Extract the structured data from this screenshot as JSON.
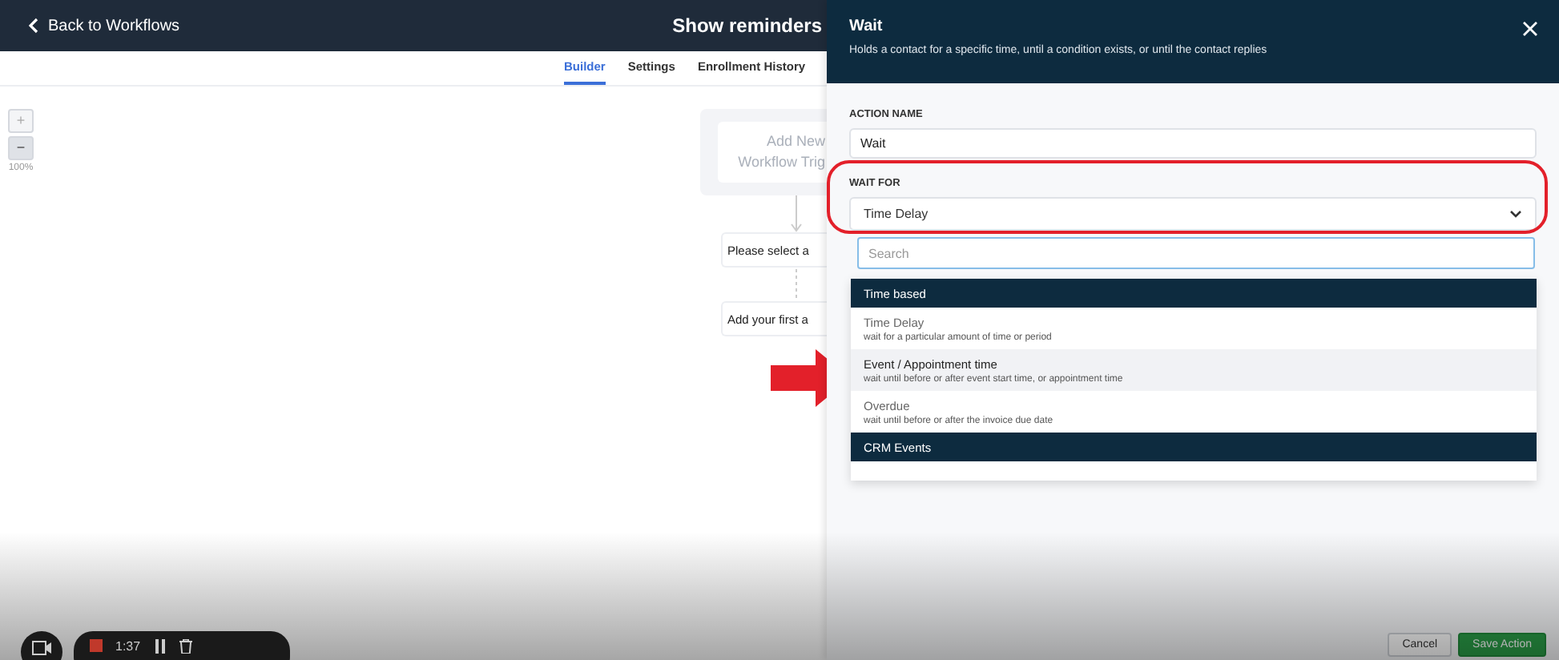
{
  "top_bar": {
    "back_label": "Back to Workflows",
    "title": "Show reminders"
  },
  "tabs": [
    {
      "label": "Builder",
      "selected": true
    },
    {
      "label": "Settings",
      "selected": false
    },
    {
      "label": "Enrollment History",
      "selected": false
    }
  ],
  "zoom_controls": {
    "zoom_in": "+",
    "zoom_out": "−",
    "level": "100%"
  },
  "canvas": {
    "trigger_lines": [
      "Add New",
      "Workflow Trig"
    ],
    "nodes": [
      "Please select a",
      "Add your first a"
    ]
  },
  "drawer": {
    "title": "Wait",
    "subtitle": "Holds a contact for a specific time, until a condition exists, or until the contact replies",
    "action_name": {
      "label": "ACTION NAME",
      "value": "Wait"
    },
    "wait_for": {
      "label": "WAIT FOR",
      "value": "Time Delay",
      "expanded": true
    },
    "search": {
      "placeholder": "Search"
    },
    "groups": [
      {
        "name": "Time based",
        "options": [
          {
            "title": "Time Delay",
            "description": "wait for a particular amount of time or period",
            "highlighted": false
          },
          {
            "title": "Event / Appointment time",
            "description": "wait until before or after event start time, or appointment time",
            "highlighted": true
          },
          {
            "title": "Overdue",
            "description": "wait until before or after the invoice due date",
            "highlighted": false
          }
        ]
      },
      {
        "name": "CRM Events"
      }
    ],
    "buttons": [
      {
        "label": "Cancel",
        "kind": "secondary"
      },
      {
        "label": "Save Action",
        "kind": "primary"
      }
    ]
  },
  "recorder": {
    "time": "1:37"
  }
}
